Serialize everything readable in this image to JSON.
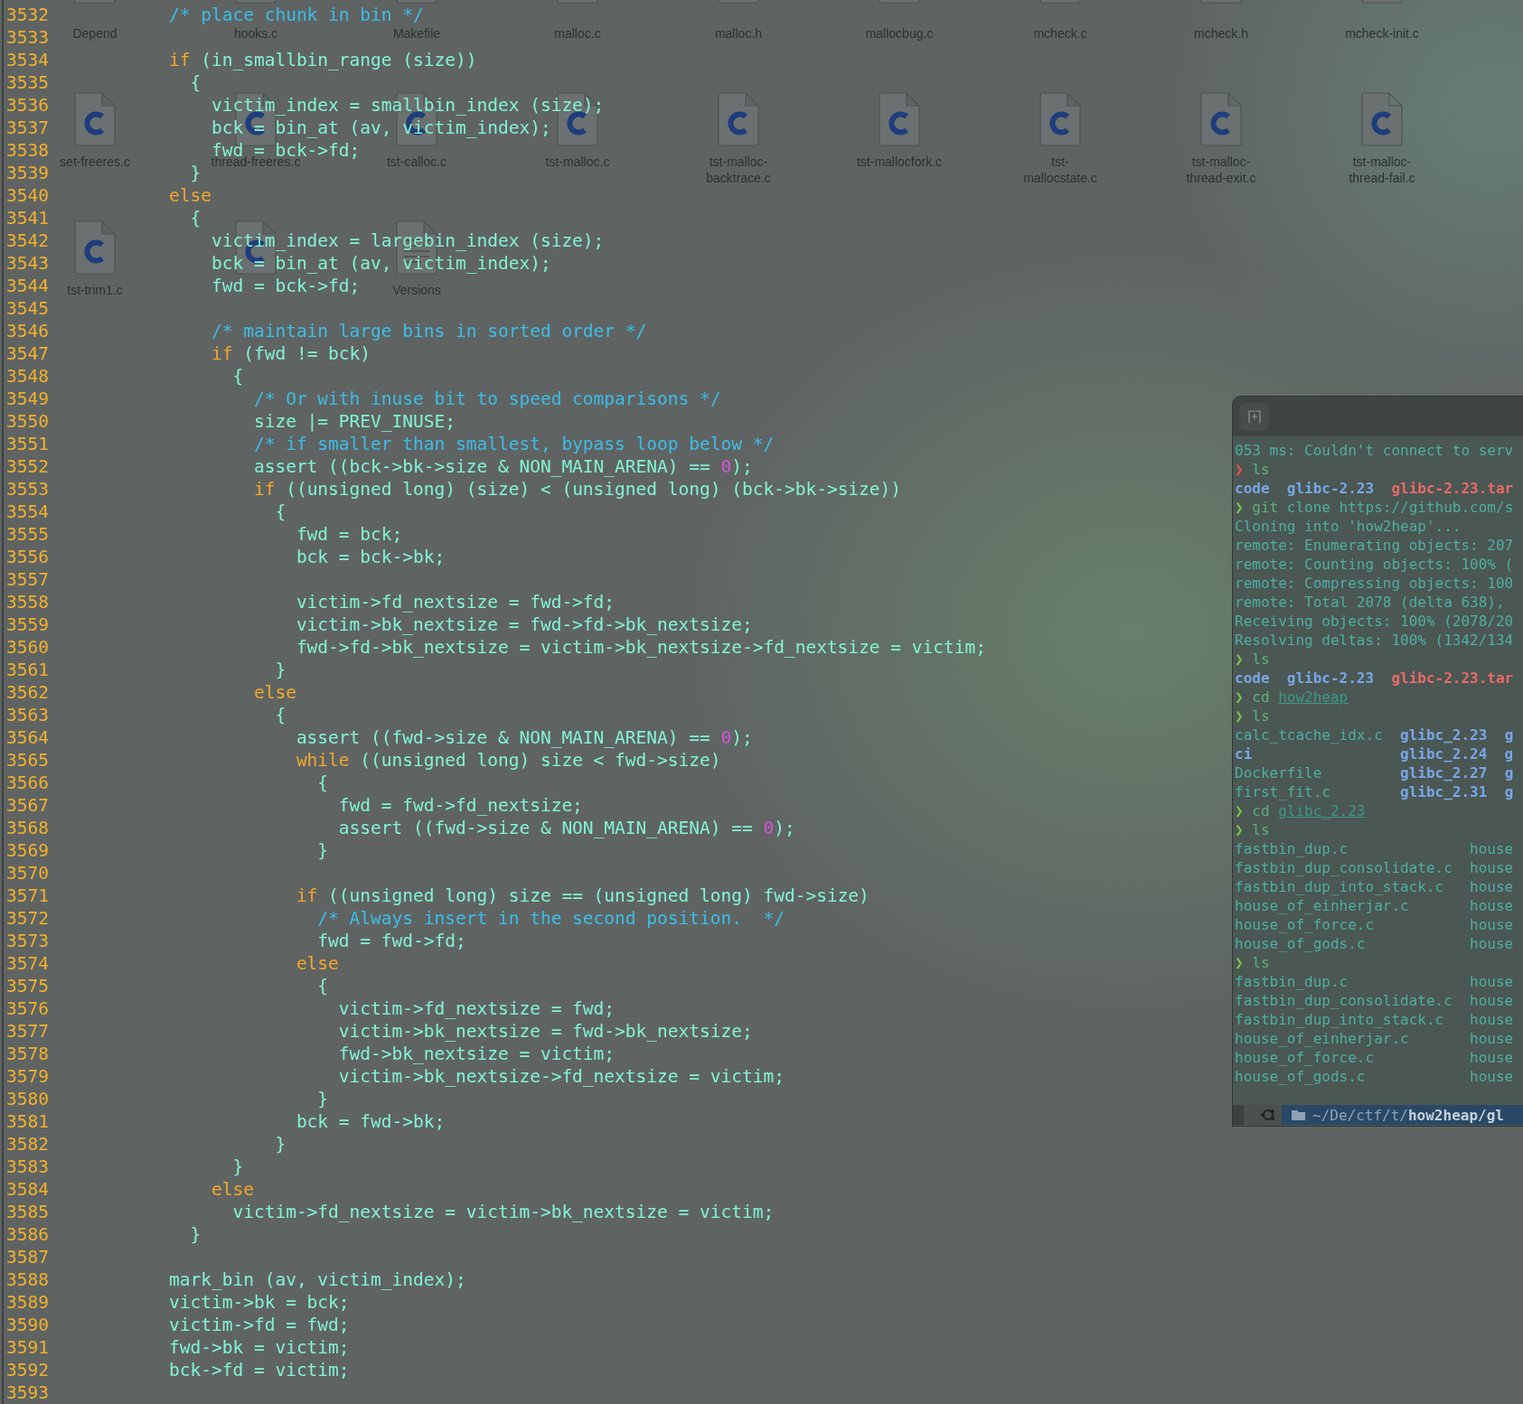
{
  "file_manager": {
    "icons": [
      {
        "kind": "text",
        "label": "Depend"
      },
      {
        "kind": "c",
        "label": "hooks.c"
      },
      {
        "kind": "make",
        "label": "Makefile"
      },
      {
        "kind": "c",
        "label": "malloc.c"
      },
      {
        "kind": "h",
        "label": "malloc.h"
      },
      {
        "kind": "c",
        "label": "mallocbug.c"
      },
      {
        "kind": "c",
        "label": "mcheck.c"
      },
      {
        "kind": "h",
        "label": "mcheck.h"
      },
      {
        "kind": "c",
        "label": "mcheck-init.c"
      },
      {
        "kind": "c",
        "label": "set-freeres.c"
      },
      {
        "kind": "c",
        "label": "thread-freeres.c"
      },
      {
        "kind": "c",
        "label": "tst-calloc.c"
      },
      {
        "kind": "c",
        "label": "tst-malloc.c"
      },
      {
        "kind": "c",
        "label": "tst-malloc-backtrace.c"
      },
      {
        "kind": "c",
        "label": "tst-mallocfork.c"
      },
      {
        "kind": "c",
        "label": "tst-mallocstate.c"
      },
      {
        "kind": "c",
        "label": "tst-malloc-thread-exit.c"
      },
      {
        "kind": "c",
        "label": "tst-malloc-thread-fail.c"
      },
      {
        "kind": "c",
        "label": "tst-trim1.c"
      },
      {
        "kind": "c"
      },
      {
        "kind": "text",
        "label": "Versions"
      }
    ]
  },
  "editor": {
    "lines": [
      {
        "number": "3532",
        "code": [
          {
            "kind": "comment",
            "text": "/* place chunk in bin */"
          }
        ]
      },
      {
        "number": "3533"
      },
      {
        "number": "3534",
        "code": [
          {
            "kind": "keyword",
            "text": "if"
          },
          {
            "kind": "plain",
            "text": " (in_smallbin_range (size))"
          }
        ]
      },
      {
        "number": "3535",
        "code": [
          {
            "kind": "plain",
            "text": "  {"
          }
        ]
      },
      {
        "number": "3536",
        "code": [
          {
            "kind": "plain",
            "text": "    victim_index = smallbin_index (size);"
          }
        ]
      },
      {
        "number": "3537",
        "code": [
          {
            "kind": "plain",
            "text": "    bck = bin_at (av, victim_index);"
          }
        ]
      },
      {
        "number": "3538",
        "code": [
          {
            "kind": "plain",
            "text": "    fwd = bck->fd;"
          }
        ]
      },
      {
        "number": "3539",
        "code": [
          {
            "kind": "plain",
            "text": "  }"
          }
        ]
      },
      {
        "number": "3540",
        "code": [
          {
            "kind": "keyword",
            "text": "else"
          }
        ]
      },
      {
        "number": "3541",
        "code": [
          {
            "kind": "plain",
            "text": "  {"
          }
        ]
      },
      {
        "number": "3542",
        "code": [
          {
            "kind": "plain",
            "text": "    victim_index = largebin_index (size);"
          }
        ]
      },
      {
        "number": "3543",
        "code": [
          {
            "kind": "plain",
            "text": "    bck = bin_at (av, victim_index);"
          }
        ]
      },
      {
        "number": "3544",
        "code": [
          {
            "kind": "plain",
            "text": "    fwd = bck->fd;"
          }
        ]
      },
      {
        "number": "3545"
      },
      {
        "number": "3546",
        "code": [
          {
            "kind": "comment",
            "text": "    /* maintain large bins in sorted order */"
          }
        ]
      },
      {
        "number": "3547",
        "code": [
          {
            "kind": "keyword",
            "text": "    if"
          },
          {
            "kind": "plain",
            "text": " (fwd != bck)"
          }
        ]
      },
      {
        "number": "3548",
        "code": [
          {
            "kind": "plain",
            "text": "      {"
          }
        ]
      },
      {
        "number": "3549",
        "code": [
          {
            "kind": "comment",
            "text": "        /* Or with inuse bit to speed comparisons */"
          }
        ]
      },
      {
        "number": "3550",
        "code": [
          {
            "kind": "plain",
            "text": "        size |= PREV_INUSE;"
          }
        ]
      },
      {
        "number": "3551",
        "code": [
          {
            "kind": "comment",
            "text": "        /* if smaller than smallest, bypass loop below */"
          }
        ]
      },
      {
        "number": "3552",
        "code": [
          {
            "kind": "plain",
            "text": "        assert ((bck->bk->size & NON_MAIN_ARENA) == "
          },
          {
            "kind": "number",
            "text": "0"
          },
          {
            "kind": "plain",
            "text": ");"
          }
        ]
      },
      {
        "number": "3553",
        "code": [
          {
            "kind": "keyword",
            "text": "        if"
          },
          {
            "kind": "plain",
            "text": " ((unsigned long) (size) < (unsigned long) (bck->bk->size))"
          }
        ]
      },
      {
        "number": "3554",
        "code": [
          {
            "kind": "plain",
            "text": "          {"
          }
        ]
      },
      {
        "number": "3555",
        "code": [
          {
            "kind": "plain",
            "text": "            fwd = bck;"
          }
        ]
      },
      {
        "number": "3556",
        "code": [
          {
            "kind": "plain",
            "text": "            bck = bck->bk;"
          }
        ]
      },
      {
        "number": "3557"
      },
      {
        "number": "3558",
        "code": [
          {
            "kind": "plain",
            "text": "            victim->fd_nextsize = fwd->fd;"
          }
        ]
      },
      {
        "number": "3559",
        "code": [
          {
            "kind": "plain",
            "text": "            victim->bk_nextsize = fwd->fd->bk_nextsize;"
          }
        ]
      },
      {
        "number": "3560",
        "code": [
          {
            "kind": "plain",
            "text": "            fwd->fd->bk_nextsize = victim->bk_nextsize->fd_nextsize = victim;"
          }
        ]
      },
      {
        "number": "3561",
        "code": [
          {
            "kind": "plain",
            "text": "          }"
          }
        ]
      },
      {
        "number": "3562",
        "code": [
          {
            "kind": "keyword",
            "text": "        else"
          }
        ]
      },
      {
        "number": "3563",
        "code": [
          {
            "kind": "plain",
            "text": "          {"
          }
        ]
      },
      {
        "number": "3564",
        "code": [
          {
            "kind": "plain",
            "text": "            assert ((fwd->size & NON_MAIN_ARENA) == "
          },
          {
            "kind": "number",
            "text": "0"
          },
          {
            "kind": "plain",
            "text": ");"
          }
        ]
      },
      {
        "number": "3565",
        "code": [
          {
            "kind": "keyword",
            "text": "            while"
          },
          {
            "kind": "plain",
            "text": " ((unsigned long) size < fwd->size)"
          }
        ]
      },
      {
        "number": "3566",
        "code": [
          {
            "kind": "plain",
            "text": "              {"
          }
        ]
      },
      {
        "number": "3567",
        "code": [
          {
            "kind": "plain",
            "text": "                fwd = fwd->fd_nextsize;"
          }
        ]
      },
      {
        "number": "3568",
        "code": [
          {
            "kind": "plain",
            "text": "                assert ((fwd->size & NON_MAIN_ARENA) == "
          },
          {
            "kind": "number",
            "text": "0"
          },
          {
            "kind": "plain",
            "text": ");"
          }
        ]
      },
      {
        "number": "3569",
        "code": [
          {
            "kind": "plain",
            "text": "              }"
          }
        ]
      },
      {
        "number": "3570"
      },
      {
        "number": "3571",
        "code": [
          {
            "kind": "keyword",
            "text": "            if"
          },
          {
            "kind": "plain",
            "text": " ((unsigned long) size == (unsigned long) fwd->size)"
          }
        ]
      },
      {
        "number": "3572",
        "code": [
          {
            "kind": "comment",
            "text": "              /* Always insert in the second position.  */"
          }
        ]
      },
      {
        "number": "3573",
        "code": [
          {
            "kind": "plain",
            "text": "              fwd = fwd->fd;"
          }
        ]
      },
      {
        "number": "3574",
        "code": [
          {
            "kind": "keyword",
            "text": "            else"
          }
        ]
      },
      {
        "number": "3575",
        "code": [
          {
            "kind": "plain",
            "text": "              {"
          }
        ]
      },
      {
        "number": "3576",
        "code": [
          {
            "kind": "plain",
            "text": "                victim->fd_nextsize = fwd;"
          }
        ]
      },
      {
        "number": "3577",
        "code": [
          {
            "kind": "plain",
            "text": "                victim->bk_nextsize = fwd->bk_nextsize;"
          }
        ]
      },
      {
        "number": "3578",
        "code": [
          {
            "kind": "plain",
            "text": "                fwd->bk_nextsize = victim;"
          }
        ]
      },
      {
        "number": "3579",
        "code": [
          {
            "kind": "plain",
            "text": "                victim->bk_nextsize->fd_nextsize = victim;"
          }
        ]
      },
      {
        "number": "3580",
        "code": [
          {
            "kind": "plain",
            "text": "              }"
          }
        ]
      },
      {
        "number": "3581",
        "code": [
          {
            "kind": "plain",
            "text": "            bck = fwd->bk;"
          }
        ]
      },
      {
        "number": "3582",
        "code": [
          {
            "kind": "plain",
            "text": "          }"
          }
        ]
      },
      {
        "number": "3583",
        "code": [
          {
            "kind": "plain",
            "text": "      }"
          }
        ]
      },
      {
        "number": "3584",
        "code": [
          {
            "kind": "keyword",
            "text": "    else"
          }
        ]
      },
      {
        "number": "3585",
        "code": [
          {
            "kind": "plain",
            "text": "      victim->fd_nextsize = victim->bk_nextsize = victim;"
          }
        ]
      },
      {
        "number": "3586",
        "code": [
          {
            "kind": "plain",
            "text": "  }"
          }
        ]
      },
      {
        "number": "3587"
      },
      {
        "number": "3588",
        "code": [
          {
            "kind": "plain",
            "text": "mark_bin (av, victim_index);"
          }
        ]
      },
      {
        "number": "3589",
        "code": [
          {
            "kind": "plain",
            "text": "victim->bk = bck;"
          }
        ]
      },
      {
        "number": "3590",
        "code": [
          {
            "kind": "plain",
            "text": "victim->fd = fwd;"
          }
        ]
      },
      {
        "number": "3591",
        "code": [
          {
            "kind": "plain",
            "text": "fwd->bk = victim;"
          }
        ]
      },
      {
        "number": "3592",
        "code": [
          {
            "kind": "plain",
            "text": "bck->fd = victim;"
          }
        ]
      },
      {
        "number": "3593"
      }
    ]
  },
  "terminal": {
    "lines": [
      [
        {
          "kind": "text",
          "text": "053 ms: Couldn't connect to serv"
        }
      ],
      [
        {
          "kind": "prompt_error",
          "text": "❯"
        },
        {
          "kind": "command",
          "text": " ls"
        }
      ],
      [
        {
          "kind": "dir",
          "text": "code"
        },
        {
          "kind": "dir",
          "text": "  glibc-2.23"
        },
        {
          "kind": "archive",
          "text": "  glibc-2.23.tar"
        }
      ],
      [
        {
          "kind": "prompt",
          "text": "❯"
        },
        {
          "kind": "command",
          "text": " git"
        },
        {
          "kind": "text",
          "text": " clone https://github.com/s"
        }
      ],
      [
        {
          "kind": "text",
          "text": "Cloning into 'how2heap'..."
        }
      ],
      [
        {
          "kind": "text",
          "text": "remote: Enumerating objects: 207"
        }
      ],
      [
        {
          "kind": "text",
          "text": "remote: Counting objects: 100% ("
        }
      ],
      [
        {
          "kind": "text",
          "text": "remote: Compressing objects: 100"
        }
      ],
      [
        {
          "kind": "text",
          "text": "remote: Total 2078 (delta 638),"
        }
      ],
      [
        {
          "kind": "text",
          "text": "Receiving objects: 100% (2078/20"
        }
      ],
      [
        {
          "kind": "text",
          "text": "Resolving deltas: 100% (1342/134"
        }
      ],
      [
        {
          "kind": "prompt",
          "text": "❯"
        },
        {
          "kind": "command",
          "text": " ls"
        }
      ],
      [
        {
          "kind": "dir",
          "text": "code"
        },
        {
          "kind": "dir",
          "text": "  glibc-2.23"
        },
        {
          "kind": "archive",
          "text": "  glibc-2.23.tar"
        }
      ],
      [
        {
          "kind": "prompt",
          "text": "❯"
        },
        {
          "kind": "command",
          "text": " cd "
        },
        {
          "kind": "link",
          "text": "how2heap"
        }
      ],
      [
        {
          "kind": "prompt",
          "text": "❯"
        },
        {
          "kind": "command",
          "text": " ls"
        }
      ],
      [
        {
          "kind": "text",
          "text": "calc_tcache_idx.c  "
        },
        {
          "kind": "dir",
          "text": "glibc_2.23  g"
        }
      ],
      [
        {
          "kind": "dir",
          "text": "ci                 glibc_2.24  g"
        }
      ],
      [
        {
          "kind": "text",
          "text": "Dockerfile         "
        },
        {
          "kind": "dir",
          "text": "glibc_2.27  g"
        }
      ],
      [
        {
          "kind": "text",
          "text": "first_fit.c        "
        },
        {
          "kind": "dir",
          "text": "glibc_2.31  g"
        }
      ],
      [
        {
          "kind": "prompt",
          "text": "❯"
        },
        {
          "kind": "command",
          "text": " cd "
        },
        {
          "kind": "link",
          "text": "glibc_2.23"
        }
      ],
      [
        {
          "kind": "prompt",
          "text": "❯"
        },
        {
          "kind": "command",
          "text": " ls"
        }
      ],
      [
        {
          "kind": "text",
          "text": "fastbin_dup.c              house"
        }
      ],
      [
        {
          "kind": "text",
          "text": "fastbin_dup_consolidate.c  house"
        }
      ],
      [
        {
          "kind": "text",
          "text": "fastbin_dup_into_stack.c   house"
        }
      ],
      [
        {
          "kind": "text",
          "text": "house_of_einherjar.c       house"
        }
      ],
      [
        {
          "kind": "text",
          "text": "house_of_force.c           house"
        }
      ],
      [
        {
          "kind": "text",
          "text": "house_of_gods.c            house"
        }
      ],
      [
        {
          "kind": "prompt",
          "text": "❯"
        },
        {
          "kind": "command",
          "text": " ls"
        }
      ],
      [
        {
          "kind": "text",
          "text": "fastbin_dup.c              house"
        }
      ],
      [
        {
          "kind": "text",
          "text": "fastbin_dup_consolidate.c  house"
        }
      ],
      [
        {
          "kind": "text",
          "text": "fastbin_dup_into_stack.c   house"
        }
      ],
      [
        {
          "kind": "text",
          "text": "house_of_einherjar.c       house"
        }
      ],
      [
        {
          "kind": "text",
          "text": "house_of_force.c           house"
        }
      ],
      [
        {
          "kind": "text",
          "text": "house_of_gods.c            house"
        }
      ]
    ],
    "path": "~/De/ctf/t/**how2heap/gl**"
  }
}
